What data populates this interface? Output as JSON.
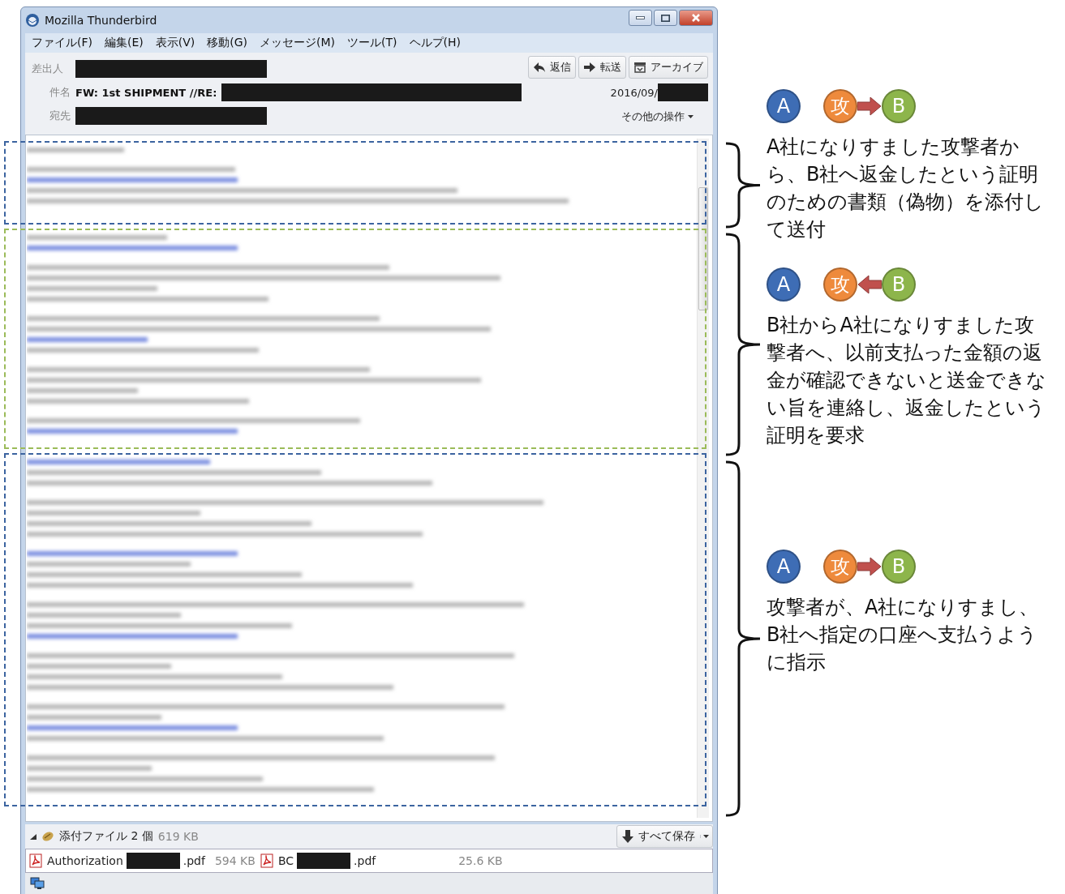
{
  "window": {
    "title": "Mozilla Thunderbird"
  },
  "menu": [
    "ファイル(F)",
    "編集(E)",
    "表示(V)",
    "移動(G)",
    "メッセージ(M)",
    "ツール(T)",
    "ヘルプ(H)"
  ],
  "header": {
    "fields": [
      {
        "label": "差出人"
      },
      {
        "label": "件名",
        "value": "FW: 1st SHIPMENT //RE:"
      },
      {
        "label": "宛先"
      }
    ],
    "buttons": [
      {
        "kind": "reply",
        "label": "返信"
      },
      {
        "kind": "forward",
        "label": "転送"
      },
      {
        "kind": "archive",
        "label": "アーカイブ"
      }
    ],
    "date": "2016/09/",
    "more_actions": "その他の操作"
  },
  "body_sections": [
    {
      "color": "#3c64a0"
    },
    {
      "color": "#9bbb59"
    },
    {
      "color": "#3c64a0"
    }
  ],
  "attachments": {
    "summary": "添付ファイル 2 個",
    "total_size": "619 KB",
    "save_all": "すべて保存",
    "files": [
      {
        "name_start": "Authorization",
        "name_end": ".pdf",
        "size": "594 KB"
      },
      {
        "name_start": "BC",
        "name_end": ".pdf",
        "size": "25.6 KB"
      }
    ]
  },
  "annotations": [
    {
      "kind": "forward",
      "nodes": [
        {
          "label": "A",
          "color": "#3e6db5"
        },
        {
          "label": "攻",
          "color": "#ee8a3c"
        },
        {
          "label": "B",
          "color": "#8db54b"
        }
      ],
      "text": "A社になりすました攻撃者から、B社へ返金したという証明のための書類（偽物）を添付して送付"
    },
    {
      "kind": "backward",
      "nodes": [
        {
          "label": "A",
          "color": "#3e6db5"
        },
        {
          "label": "攻",
          "color": "#ee8a3c"
        },
        {
          "label": "B",
          "color": "#8db54b"
        }
      ],
      "text": "B社からA社になりすました攻撃者へ、以前支払った金額の返金が確認できないと送金できない旨を連絡し、返金したという証明を要求"
    },
    {
      "kind": "forward",
      "nodes": [
        {
          "label": "A",
          "color": "#3e6db5"
        },
        {
          "label": "攻",
          "color": "#ee8a3c"
        },
        {
          "label": "B",
          "color": "#8db54b"
        }
      ],
      "text": "攻撃者が、A社になりすまし、B社へ指定の口座へ支払うように指示"
    }
  ]
}
